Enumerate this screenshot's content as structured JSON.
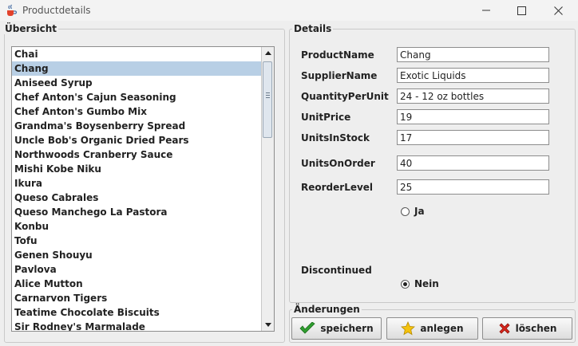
{
  "window": {
    "title": "Productdetails",
    "icons": {
      "app": "java-cup-icon",
      "minimize": "minimize-icon",
      "maximize": "maximize-icon",
      "close": "close-icon"
    }
  },
  "overview": {
    "legend": "Übersicht",
    "selected_index": 1,
    "items": [
      "Chai",
      "Chang",
      "Aniseed Syrup",
      "Chef Anton's Cajun Seasoning",
      "Chef Anton's Gumbo Mix",
      "Grandma's Boysenberry Spread",
      "Uncle Bob's Organic Dried Pears",
      "Northwoods Cranberry Sauce",
      "Mishi Kobe Niku",
      "Ikura",
      "Queso Cabrales",
      "Queso Manchego La Pastora",
      "Konbu",
      "Tofu",
      "Genen Shouyu",
      "Pavlova",
      "Alice Mutton",
      "Carnarvon Tigers",
      "Teatime Chocolate Biscuits",
      "Sir Rodney's Marmalade"
    ]
  },
  "details": {
    "legend": "Details",
    "fields": [
      {
        "label": "ProductName",
        "value": "Chang"
      },
      {
        "label": "SupplierName",
        "value": "Exotic Liquids"
      },
      {
        "label": "QuantityPerUnit",
        "value": "24 - 12 oz bottles"
      },
      {
        "label": "UnitPrice",
        "value": "19"
      },
      {
        "label": "UnitsInStock",
        "value": "17"
      },
      {
        "label": "UnitsOnOrder",
        "value": "40"
      },
      {
        "label": "ReorderLevel",
        "value": "25"
      }
    ],
    "discontinued": {
      "label": "Discontinued",
      "options": [
        {
          "label": "Ja",
          "checked": false
        },
        {
          "label": "Nein",
          "checked": true
        }
      ]
    }
  },
  "changes": {
    "legend": "Änderungen",
    "buttons": [
      {
        "label": "speichern",
        "icon": "checkmark-icon"
      },
      {
        "label": "anlegen",
        "icon": "star-icon"
      },
      {
        "label": "löschen",
        "icon": "x-icon"
      }
    ]
  },
  "colors": {
    "selection": "#b8cfe5",
    "check_green": "#2f9e2f",
    "star_yellow": "#f4c20d",
    "delete_red": "#d9261c"
  }
}
